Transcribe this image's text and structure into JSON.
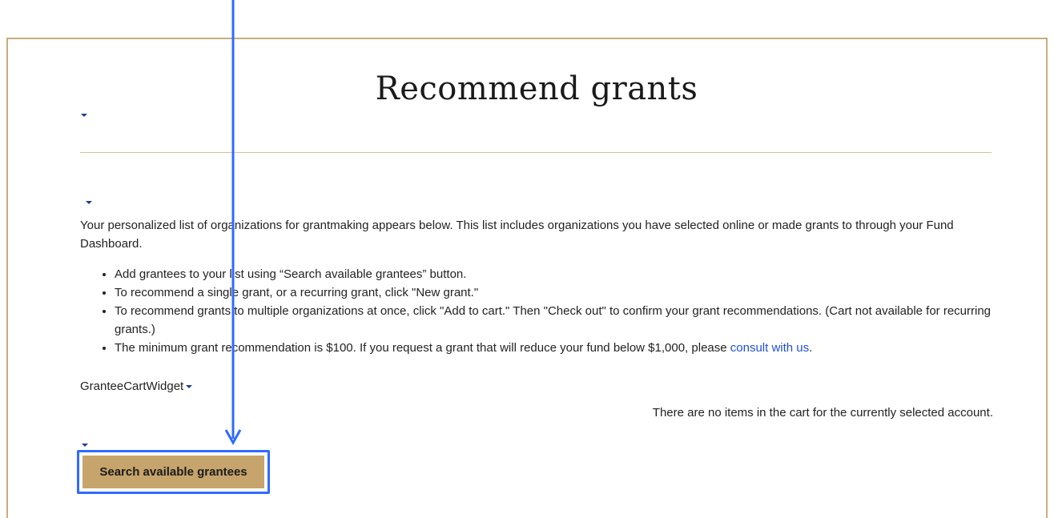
{
  "page": {
    "title": "Recommend grants",
    "intro": "Your personalized list of organizations for grantmaking appears below. This list includes organizations you have selected online or made grants to through your Fund Dashboard.",
    "bullets": [
      "Add grantees to your list using “Search available grantees” button.",
      "To recommend a single grant, or a recurring grant, click \"New grant.\"",
      "To recommend grants to multiple organizations at once, click \"Add to cart.\" Then \"Check out\" to confirm your grant recommendations. (Cart not available for recurring grants.)",
      "The minimum grant recommendation is $100. If you request a grant that will reduce your fund below $1,000, please "
    ],
    "consult_link": "consult with us",
    "consult_suffix": ".",
    "widget_label": "GranteeCartWidget",
    "cart_message": "There are no items in the cart for the currently selected account.",
    "search_button": "Search available grantees"
  },
  "colors": {
    "frame_border": "#c8ad7d",
    "button_bg": "#c6a46b",
    "highlight": "#2f6bff",
    "link": "#1f4fd8",
    "caret": "#1f3c9c"
  },
  "icons": {
    "caret": "caret-down-icon",
    "annotation": "arrow-down-icon"
  }
}
